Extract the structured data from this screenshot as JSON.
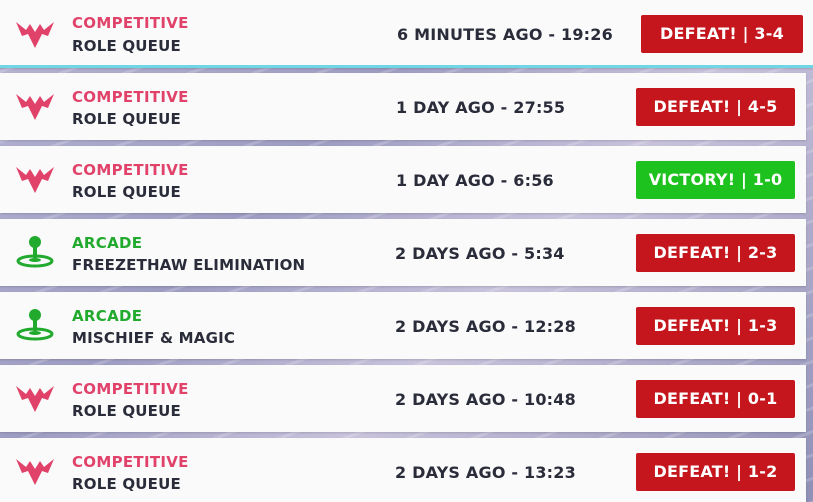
{
  "matches": [
    {
      "icon": "competitive-icon",
      "mode": "COMPETITIVE",
      "submode": "ROLE QUEUE",
      "time": "6 MINUTES AGO - 19:26",
      "result": "DEFEAT! | 3-4",
      "outcome": "defeat"
    },
    {
      "icon": "competitive-icon",
      "mode": "COMPETITIVE",
      "submode": "ROLE QUEUE",
      "time": "1 DAY AGO - 27:55",
      "result": "DEFEAT! | 4-5",
      "outcome": "defeat"
    },
    {
      "icon": "competitive-icon",
      "mode": "COMPETITIVE",
      "submode": "ROLE QUEUE",
      "time": "1 DAY AGO - 6:56",
      "result": "VICTORY! | 1-0",
      "outcome": "victory"
    },
    {
      "icon": "joystick-icon",
      "mode": "ARCADE",
      "submode": "FREEZETHAW ELIMINATION",
      "time": "2 DAYS AGO - 5:34",
      "result": "DEFEAT! | 2-3",
      "outcome": "defeat"
    },
    {
      "icon": "joystick-icon",
      "mode": "ARCADE",
      "submode": "MISCHIEF & MAGIC",
      "time": "2 DAYS AGO - 12:28",
      "result": "DEFEAT! | 1-3",
      "outcome": "defeat"
    },
    {
      "icon": "competitive-icon",
      "mode": "COMPETITIVE",
      "submode": "ROLE QUEUE",
      "time": "2 DAYS AGO - 10:48",
      "result": "DEFEAT! | 0-1",
      "outcome": "defeat"
    },
    {
      "icon": "competitive-icon",
      "mode": "COMPETITIVE",
      "submode": "ROLE QUEUE",
      "time": "2 DAYS AGO - 13:23",
      "result": "DEFEAT! | 1-2",
      "outcome": "defeat"
    }
  ],
  "colors": {
    "competitive": "#e0426a",
    "arcade": "#22aa2e",
    "defeat": "#c4161c",
    "victory": "#1ec21e",
    "selected_border": "#6fd6e6"
  }
}
